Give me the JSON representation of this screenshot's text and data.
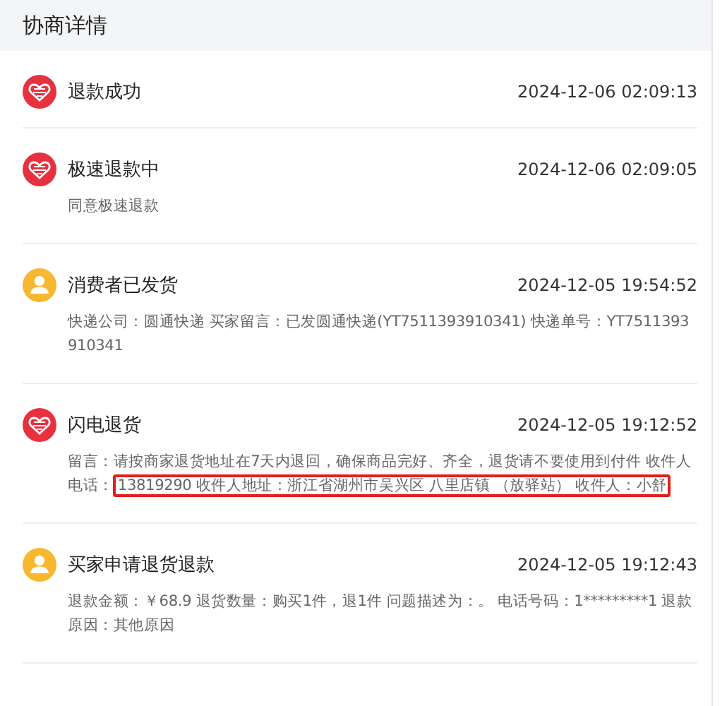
{
  "header": {
    "title": "协商详情"
  },
  "events": [
    {
      "kind": "platform",
      "title": "退款成功",
      "time": "2024-12-06 02:09:13"
    },
    {
      "kind": "platform",
      "title": "极速退款中",
      "time": "2024-12-06 02:09:05",
      "details": [
        {
          "text": "同意极速退款",
          "highlighted": false
        }
      ]
    },
    {
      "kind": "buyer",
      "title": "消费者已发货",
      "time": "2024-12-05 19:54:52",
      "details": [
        {
          "text": "快递公司：圆通快递 买家留言：已发圆通快递(YT7511393910341) 快递单号：YT7511393910341",
          "highlighted": false
        }
      ]
    },
    {
      "kind": "platform",
      "title": "闪电退货",
      "time": "2024-12-05 19:12:52",
      "details": [
        {
          "text": "留言：请按商家退货地址在7天内退回，确保商品完好、齐全，退货请不要使用到付件 收件人电话：",
          "highlighted": false
        },
        {
          "text": "13819290 收件人地址：浙江省湖州市吴兴区 八里店镇 （放驿站） 收件人：小舒",
          "highlighted": true
        }
      ]
    },
    {
      "kind": "buyer",
      "title": "买家申请退货退款",
      "time": "2024-12-05 19:12:43",
      "details": [
        {
          "text": "退款金额：￥68.9 退货数量：购买1件，退1件 问题描述为：。 电话号码：1*********1 退款原因：其他原因",
          "highlighted": false
        }
      ]
    }
  ]
}
